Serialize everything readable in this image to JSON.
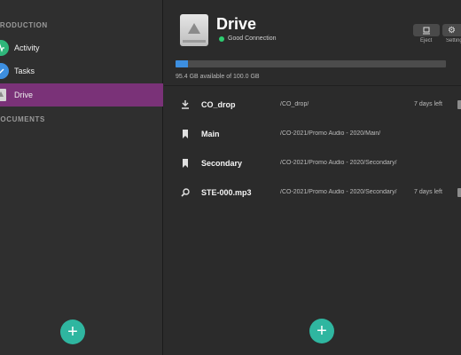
{
  "sidebar": {
    "sections": [
      {
        "label": "PRODUCTION"
      },
      {
        "label": "DOCUMENTS"
      }
    ],
    "items": [
      {
        "label": "Activity",
        "icon": "activity-icon",
        "color": "#2fb67a"
      },
      {
        "label": "Tasks",
        "icon": "tasks-icon",
        "color": "#3d8fe0"
      },
      {
        "label": "Drive",
        "icon": "drive-icon",
        "color": "#c9c9c9"
      }
    ],
    "add_label": "+"
  },
  "header": {
    "title": "Drive",
    "status": "Good Connection",
    "eject_label": "Eject",
    "settings_label": "Settings"
  },
  "storage": {
    "used_fraction": 0.046,
    "text": "95.4 GB available of 100.0 GB"
  },
  "files": [
    {
      "name": "CO_drop",
      "path": "/CO_drop/",
      "expires": "7 days left",
      "icon": "download-icon",
      "trash": true
    },
    {
      "name": "Main",
      "path": "/CO-2021/Promo Audio - 2020/Main/",
      "expires": "",
      "icon": "bookmark-icon",
      "trash": false
    },
    {
      "name": "Secondary",
      "path": "/CO-2021/Promo Audio - 2020/Secondary/",
      "expires": "",
      "icon": "bookmark-icon",
      "trash": false
    },
    {
      "name": "STE-000.mp3",
      "path": "/CO-2021/Promo Audio - 2020/Secondary/",
      "expires": "7 days left",
      "icon": "link-icon",
      "trash": true
    }
  ],
  "main": {
    "add_label": "+"
  },
  "colors": {
    "accent": "#7a3278",
    "teal": "#2fb6a0",
    "progress": "#3d8fe0"
  }
}
